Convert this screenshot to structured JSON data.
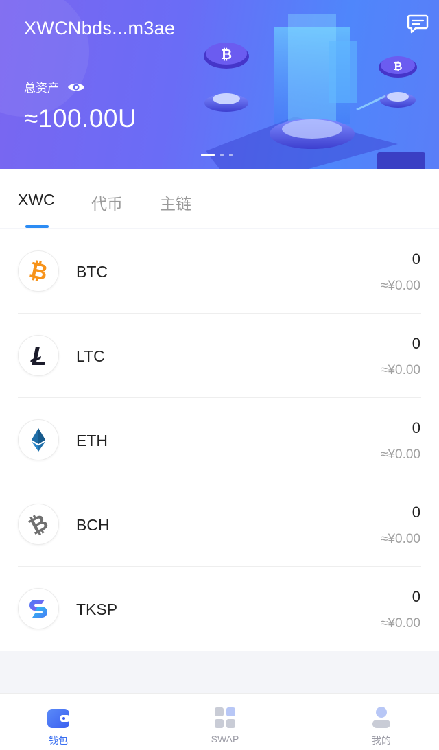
{
  "header": {
    "wallet_address": "XWCNbds...m3ae",
    "total_label": "总资产",
    "total_value": "≈100.00U",
    "message_icon": "chat-message-icon",
    "eye_icon": "eye-icon",
    "carousel": {
      "count": 3,
      "active": 0
    }
  },
  "tabs": [
    {
      "label": "XWC",
      "active": true
    },
    {
      "label": "代币",
      "active": false
    },
    {
      "label": "主链",
      "active": false
    }
  ],
  "coins": [
    {
      "symbol": "BTC",
      "amount": "0",
      "fiat": "≈¥0.00",
      "icon": "bitcoin-icon",
      "color": "#f7931a"
    },
    {
      "symbol": "LTC",
      "amount": "0",
      "fiat": "≈¥0.00",
      "icon": "litecoin-icon",
      "color": "#1b1b2a"
    },
    {
      "symbol": "ETH",
      "amount": "0",
      "fiat": "≈¥0.00",
      "icon": "ethereum-icon",
      "color": "#1f6ea8"
    },
    {
      "symbol": "BCH",
      "amount": "0",
      "fiat": "≈¥0.00",
      "icon": "bitcoin-cash-icon",
      "color": "#707070"
    },
    {
      "symbol": "TKSP",
      "amount": "0",
      "fiat": "≈¥0.00",
      "icon": "tksp-icon",
      "color": "#4a7cf5"
    }
  ],
  "bottom_nav": [
    {
      "label": "钱包",
      "icon": "wallet-icon",
      "active": true
    },
    {
      "label": "SWAP",
      "icon": "grid-apps-icon",
      "active": false
    },
    {
      "label": "我的",
      "icon": "user-profile-icon",
      "active": false
    }
  ],
  "colors": {
    "accent": "#3a6ff0",
    "tab_indicator": "#2c8cf4",
    "banner_start": "#7a66f0",
    "banner_end": "#4f86fb"
  }
}
